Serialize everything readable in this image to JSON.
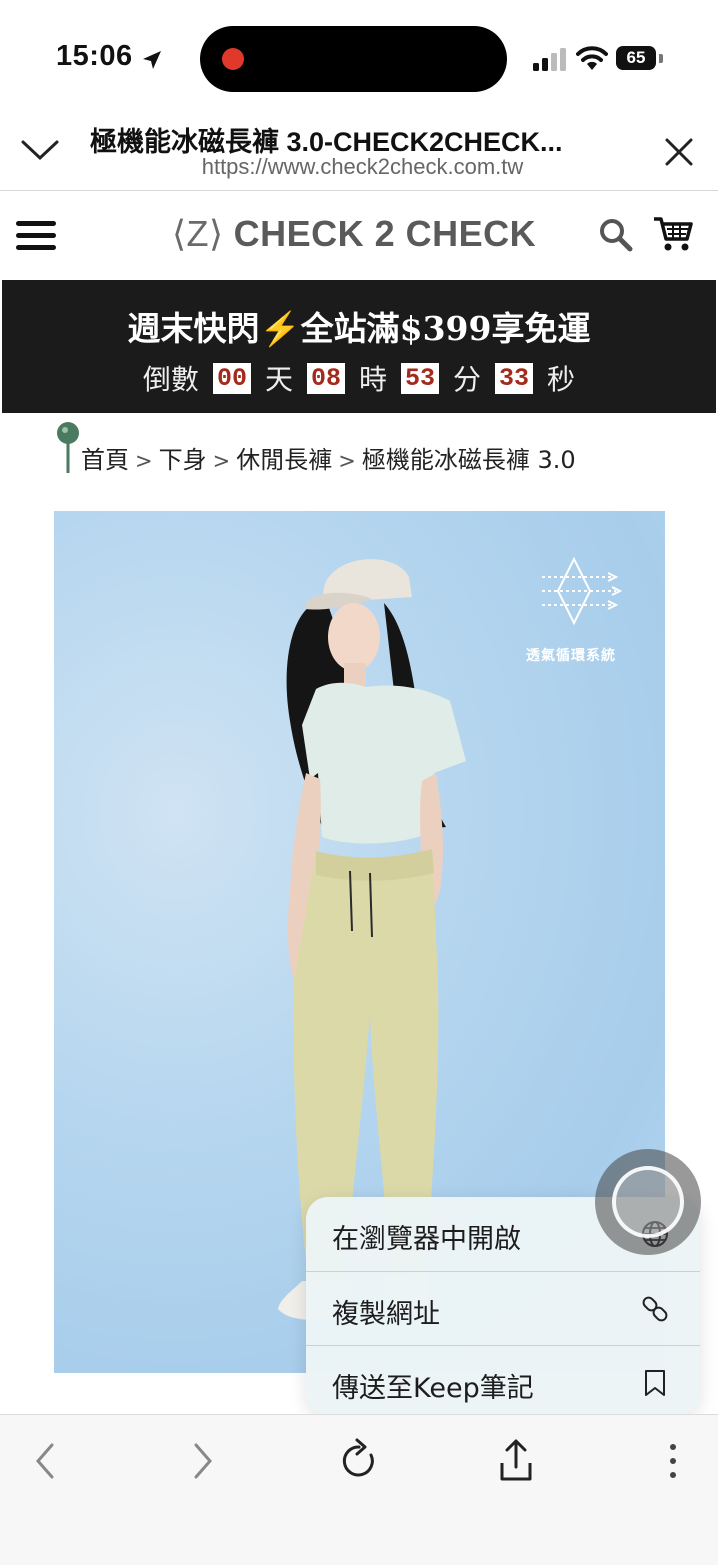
{
  "status_bar": {
    "time": "15:06",
    "battery": "65"
  },
  "browser": {
    "title": "極機能冰磁長褲 3.0-CHECK2CHECK...",
    "url": "https://www.check2check.com.tw"
  },
  "site": {
    "logo_mark": "⟨Z⟩",
    "brand_name": "CHECK 2 CHECK"
  },
  "promo": {
    "title": "週末快閃⚡全站滿$399享免運",
    "countdown_prefix": "倒數",
    "days": "00",
    "days_unit": "天",
    "hours": "08",
    "hours_unit": "時",
    "minutes": "53",
    "minutes_unit": "分",
    "seconds": "33",
    "seconds_unit": "秒"
  },
  "breadcrumb": {
    "items": [
      "首頁",
      "下身",
      "休閒長褲",
      "極機能冰磁長褲 3.0"
    ],
    "separator": ">"
  },
  "product_image": {
    "feature_label": "透氣循環系統"
  },
  "context_menu": {
    "items": [
      {
        "label": "在瀏覽器中開啟",
        "icon": "globe-icon"
      },
      {
        "label": "複製網址",
        "icon": "link-icon"
      },
      {
        "label": "傳送至Keep筆記",
        "icon": "bookmark-icon"
      }
    ]
  },
  "colors": {
    "promo_bg": "#1b1b1b",
    "countdown_digit": "#a42a1d",
    "brand_gray": "#5a5a5a",
    "pin_green": "#4a7a60"
  }
}
